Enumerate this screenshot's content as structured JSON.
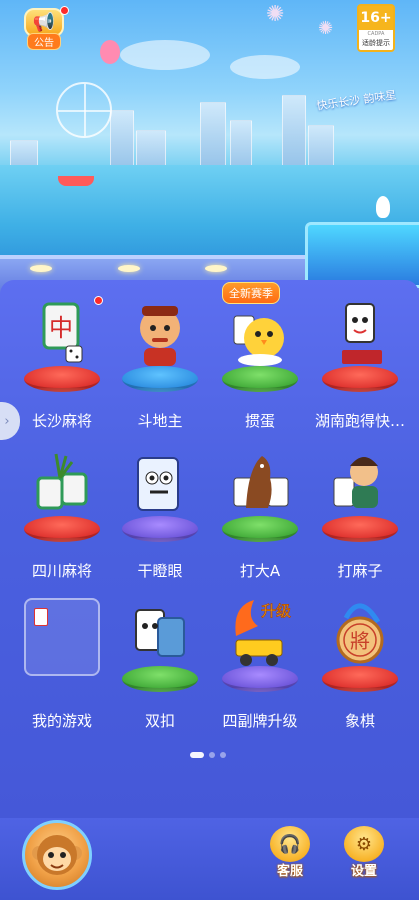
{
  "top": {
    "notice_label": "公告",
    "age_rating": "16+",
    "age_org": "CADPA",
    "age_tip": "适龄提示",
    "billboard_text": "快乐长沙 韵味星"
  },
  "games": [
    {
      "label": "长沙麻将",
      "icon": "mahjong-tile-icon",
      "badge_dot": true
    },
    {
      "label": "斗地主",
      "icon": "landlord-character-icon"
    },
    {
      "label": "掼蛋",
      "icon": "chick-cards-icon",
      "tag": "全新赛季"
    },
    {
      "label": "湖南跑得快…",
      "icon": "running-card-icon"
    },
    {
      "label": "四川麻将",
      "icon": "sichuan-mahjong-icon"
    },
    {
      "label": "干瞪眼",
      "icon": "stare-card-icon"
    },
    {
      "label": "打大A",
      "icon": "horse-cards-icon"
    },
    {
      "label": "打麻子",
      "icon": "warrior-card-icon"
    },
    {
      "label": "我的游戏",
      "icon": "my-games-icon"
    },
    {
      "label": "双扣",
      "icon": "double-cards-icon"
    },
    {
      "label": "四副牌升级",
      "icon": "upgrade-truck-icon",
      "art_text": "升级"
    },
    {
      "label": "象棋",
      "icon": "chess-piece-icon",
      "art_text": "將"
    }
  ],
  "pager": {
    "pages": 3,
    "current": 1
  },
  "bottom": {
    "service_label": "客服",
    "settings_label": "设置"
  },
  "colors": {
    "panel": "#4b61e0",
    "accent": "#f6b51d",
    "red_pedestal": "#e8312f",
    "blue_pedestal": "#2b8fe6",
    "green_pedestal": "#4fbf3a"
  }
}
